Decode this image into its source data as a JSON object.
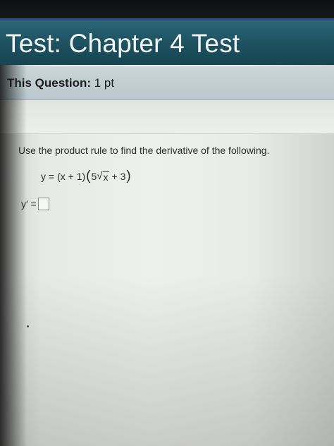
{
  "header": {
    "title": "Test: Chapter 4 Test"
  },
  "question": {
    "label": "This Question:",
    "points": "1 pt",
    "instruction": "Use the product rule to find the derivative of the following.",
    "equation": {
      "lhs": "y =",
      "factor1": "(x + 1)",
      "coef": "5",
      "radicand": "x",
      "tail": "+ 3"
    },
    "answer": {
      "label": "y′ =",
      "value": ""
    }
  },
  "colors": {
    "title_bar": "#1f5463",
    "question_header": "#c1cfd3",
    "page_background": "#eceee9"
  }
}
